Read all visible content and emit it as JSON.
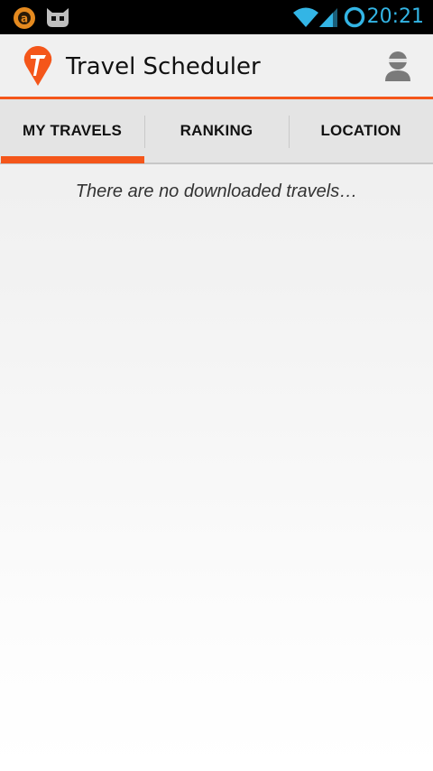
{
  "status_bar": {
    "time": "20:21",
    "icons": [
      "notification-a-icon",
      "cyanogen-mascot-icon",
      "wifi-icon",
      "cell-signal-icon",
      "sync-ring-icon"
    ]
  },
  "action_bar": {
    "title": "Travel Scheduler",
    "logo_icon": "travel-scheduler-logo-icon",
    "profile_icon": "user-profile-icon"
  },
  "tabs": [
    {
      "label": "MY TRAVELS",
      "selected": true
    },
    {
      "label": "RANKING",
      "selected": false
    },
    {
      "label": "LOCATION",
      "selected": false
    }
  ],
  "content": {
    "empty_message": "There are no downloaded travels…"
  },
  "colors": {
    "accent": "#f4561a",
    "status_blue": "#33b5e5"
  }
}
